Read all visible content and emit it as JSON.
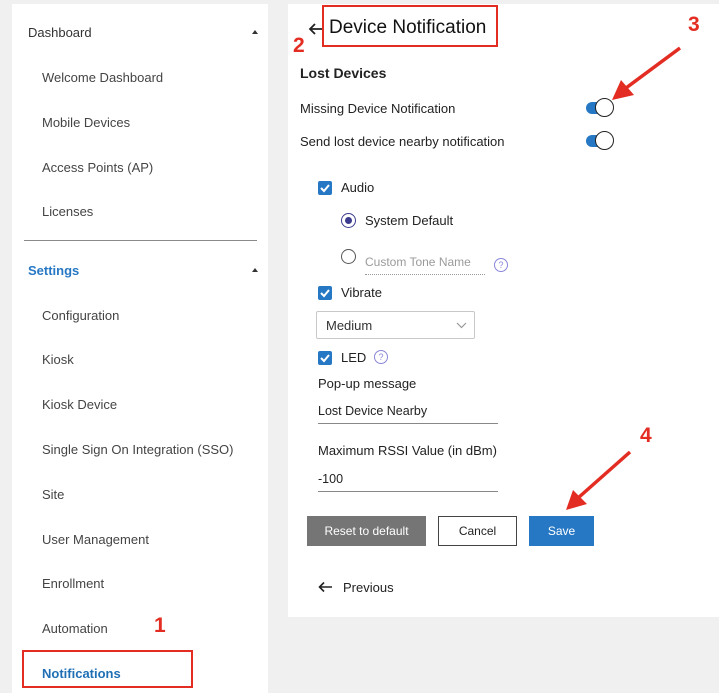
{
  "sidebar": {
    "dashboard_group": "Dashboard",
    "dashboard_items": [
      "Welcome Dashboard",
      "Mobile Devices",
      "Access Points (AP)",
      "Licenses"
    ],
    "settings_group": "Settings",
    "settings_items": [
      "Configuration",
      "Kiosk",
      "Kiosk Device",
      "Single Sign On Integration (SSO)",
      "Site",
      "User Management",
      "Enrollment",
      "Automation",
      "Notifications"
    ],
    "active_item": "Notifications"
  },
  "main": {
    "title": "Device Notification",
    "section_title": "Lost Devices",
    "missing_device_label": "Missing Device Notification",
    "missing_device_enabled": true,
    "nearby_label": "Send lost device nearby notification",
    "nearby_enabled": true,
    "audio_label": "Audio",
    "audio_checked": true,
    "system_default_label": "System Default",
    "custom_tone_placeholder": "Custom Tone Name",
    "vibrate_label": "Vibrate",
    "vibrate_checked": true,
    "vibrate_level": "Medium",
    "led_label": "LED",
    "led_checked": true,
    "popup_label": "Pop-up message",
    "popup_value": "Lost Device Nearby",
    "rssi_label": "Maximum RSSI Value (in dBm)",
    "rssi_value": "-100",
    "reset_button": "Reset to default",
    "cancel_button": "Cancel",
    "save_button": "Save",
    "previous_label": "Previous"
  },
  "annotations": [
    "1",
    "2",
    "3",
    "4"
  ],
  "colors": {
    "accent": "#2778c4",
    "annotation_red": "#e32d22",
    "reset_bg": "#757575"
  }
}
